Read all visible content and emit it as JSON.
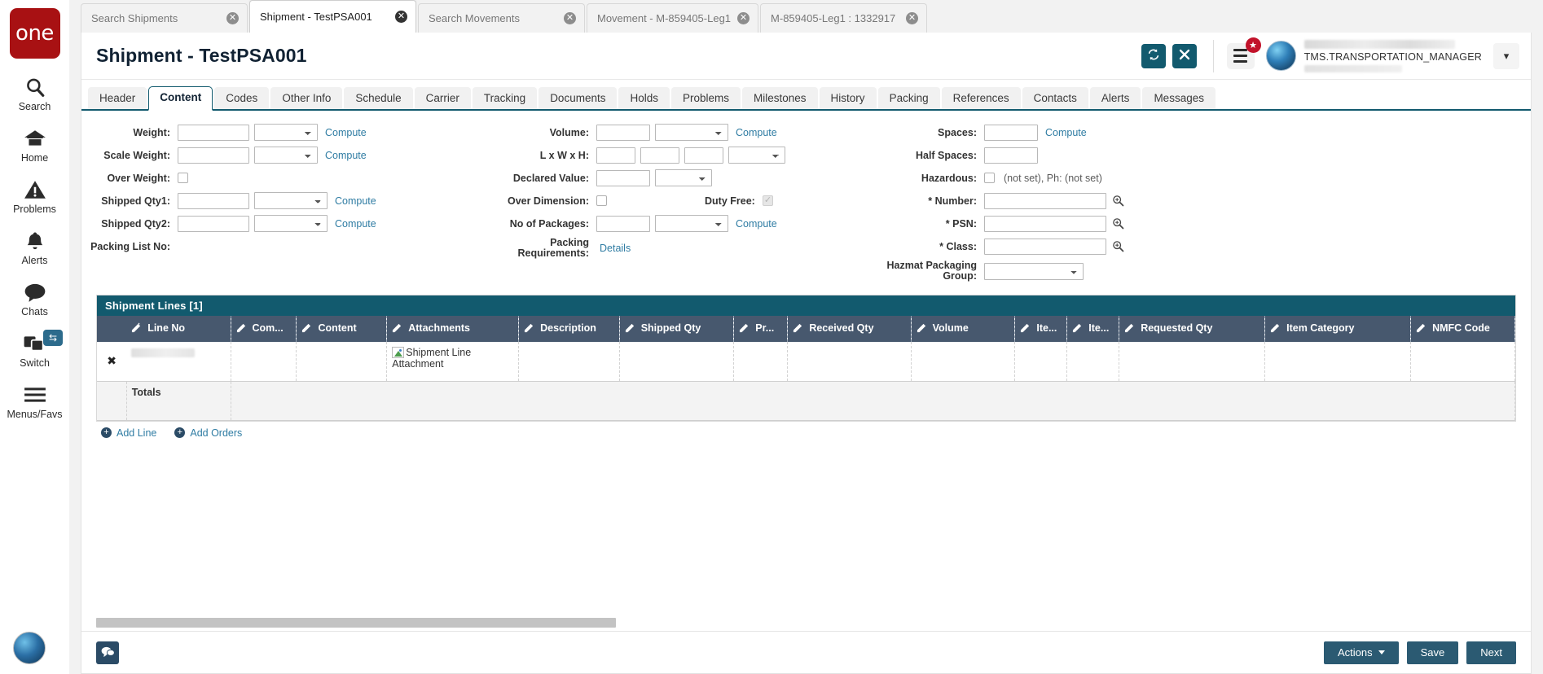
{
  "rail": {
    "logo_text": "one",
    "items": [
      {
        "label": "Search",
        "icon": "search-icon"
      },
      {
        "label": "Home",
        "icon": "home-icon"
      },
      {
        "label": "Problems",
        "icon": "warning-triangle-icon"
      },
      {
        "label": "Alerts",
        "icon": "bell-icon"
      },
      {
        "label": "Chats",
        "icon": "chat-bubble-icon"
      },
      {
        "label": "Switch",
        "icon": "windows-stack-icon"
      },
      {
        "label": "Menus/Favs",
        "icon": "hamburger-icon"
      }
    ]
  },
  "browser_tabs": [
    {
      "label": "Search Shipments",
      "active": false
    },
    {
      "label": "Shipment - TestPSA001",
      "active": true
    },
    {
      "label": "Search Movements",
      "active": false
    },
    {
      "label": "Movement - M-859405-Leg1",
      "active": false
    },
    {
      "label": "M-859405-Leg1 : 1332917",
      "active": false
    }
  ],
  "header": {
    "title": "Shipment - TestPSA001",
    "refresh_icon": "refresh-icon",
    "close_icon": "close-icon",
    "menu_icon": "hamburger-menu-icon",
    "badge_icon": "star-badge-icon",
    "avatar_icon": "user-avatar",
    "user_name": "TMS.TRANSPORTATION_MANAGER",
    "dropdown_icon": "chevron-down-icon"
  },
  "tabs": [
    {
      "label": "Header",
      "active": false
    },
    {
      "label": "Content",
      "active": true
    },
    {
      "label": "Codes",
      "active": false
    },
    {
      "label": "Other Info",
      "active": false
    },
    {
      "label": "Schedule",
      "active": false
    },
    {
      "label": "Carrier",
      "active": false
    },
    {
      "label": "Tracking",
      "active": false
    },
    {
      "label": "Documents",
      "active": false
    },
    {
      "label": "Holds",
      "active": false
    },
    {
      "label": "Problems",
      "active": false
    },
    {
      "label": "Milestones",
      "active": false
    },
    {
      "label": "History",
      "active": false
    },
    {
      "label": "Packing",
      "active": false
    },
    {
      "label": "References",
      "active": false
    },
    {
      "label": "Contacts",
      "active": false
    },
    {
      "label": "Alerts",
      "active": false
    },
    {
      "label": "Messages",
      "active": false
    }
  ],
  "form": {
    "col1": {
      "weight_label": "Weight:",
      "weight_value": "",
      "weight_uom": "",
      "weight_compute": "Compute",
      "scale_weight_label": "Scale Weight:",
      "scale_weight_value": "",
      "scale_weight_uom": "",
      "scale_weight_compute": "Compute",
      "over_weight_label": "Over Weight:",
      "shipped_qty1_label": "Shipped Qty1:",
      "shipped_qty1_value": "",
      "shipped_qty1_uom": "",
      "shipped_qty1_compute": "Compute",
      "shipped_qty2_label": "Shipped Qty2:",
      "shipped_qty2_value": "",
      "shipped_qty2_uom": "",
      "shipped_qty2_compute": "Compute",
      "packing_list_label": "Packing List No:"
    },
    "col2": {
      "volume_label": "Volume:",
      "volume_value": "",
      "volume_uom": "",
      "volume_compute": "Compute",
      "lwh_label": "L x W x H:",
      "lwh_l": "",
      "lwh_w": "",
      "lwh_h": "",
      "lwh_uom": "",
      "declared_value_label": "Declared Value:",
      "declared_value": "",
      "declared_currency": "",
      "over_dimension_label": "Over Dimension:",
      "no_of_packages_label": "No of Packages:",
      "no_of_packages_value": "",
      "no_of_packages_uom": "",
      "no_of_packages_compute": "Compute",
      "packing_requirements_label": "Packing Requirements:",
      "packing_requirements_link": "Details",
      "duty_free_label": "Duty Free:"
    },
    "col3": {
      "spaces_label": "Spaces:",
      "spaces_value": "",
      "spaces_compute": "Compute",
      "half_spaces_label": "Half Spaces:",
      "half_spaces_value": "",
      "hazardous_label": "Hazardous:",
      "hazardous_text": "(not set), Ph: (not set)",
      "number_label": "* Number:",
      "number_value": "",
      "psn_label": "* PSN:",
      "psn_value": "",
      "class_label": "* Class:",
      "class_value": "",
      "hazmat_packaging_label": "Hazmat Packaging Group:",
      "hazmat_packaging_value": "",
      "search_icon": "magnifier-icon"
    }
  },
  "grid": {
    "title": "Shipment Lines [1]",
    "columns": [
      "Line No",
      "Com...",
      "Content",
      "Attachments",
      "Description",
      "Shipped Qty",
      "Pr...",
      "Received Qty",
      "Volume",
      "Ite...",
      "Ite...",
      "Requested Qty",
      "Item Category",
      "NMFC Code"
    ],
    "rows": [
      {
        "line_no": "",
        "com": "",
        "content": "",
        "attachments": "Shipment Line Attachment",
        "description": "",
        "shipped_qty": "",
        "pr": "",
        "received_qty": "",
        "volume": "",
        "ite1": "",
        "ite2": "",
        "requested_qty": "",
        "item_category": "",
        "nmfc_code": ""
      }
    ],
    "totals_label": "Totals",
    "add_line_label": "Add Line",
    "add_orders_label": "Add Orders",
    "delete_icon": "delete-x-icon",
    "edit_icon": "edit-pencil-icon",
    "attachment_icon": "broken-image-icon"
  },
  "footer": {
    "chat_icon": "chat-icon",
    "actions_label": "Actions",
    "save_label": "Save",
    "next_label": "Next"
  },
  "colors": {
    "brand_red": "#a81113",
    "teal": "#125a6e",
    "grid_header": "#47586e",
    "link": "#2f7ca3",
    "button": "#2b5a72"
  }
}
